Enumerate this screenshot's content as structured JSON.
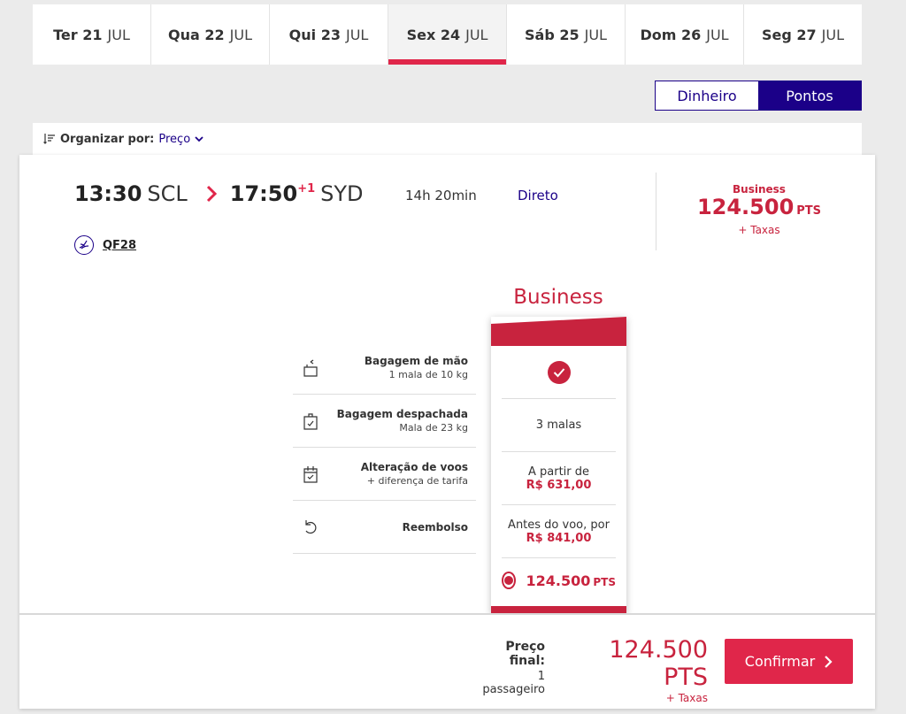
{
  "date_tabs": [
    {
      "day": "Ter 21",
      "month": "JUL"
    },
    {
      "day": "Qua 22",
      "month": "JUL"
    },
    {
      "day": "Qui 23",
      "month": "JUL"
    },
    {
      "day": "Sex 24",
      "month": "JUL",
      "active": true
    },
    {
      "day": "Sáb 25",
      "month": "JUL"
    },
    {
      "day": "Dom 26",
      "month": "JUL"
    },
    {
      "day": "Seg 27",
      "month": "JUL"
    }
  ],
  "currency_toggle": {
    "money": "Dinheiro",
    "points": "Pontos",
    "selected": "Pontos"
  },
  "sort": {
    "label": "Organizar por:",
    "value": "Preço"
  },
  "flight": {
    "depart_time": "13:30",
    "depart_airport": "SCL",
    "arrive_time": "17:50",
    "day_offset": "+1",
    "arrive_airport": "SYD",
    "duration": "14h 20min",
    "stops": "Direto",
    "flight_number": "QF28",
    "summary_cabin": "Business",
    "summary_amount": "124.500",
    "summary_unit": "PTS",
    "summary_tax": "+ Taxas"
  },
  "fare": {
    "title": "Business",
    "features": [
      {
        "icon": "carry-on-bag-icon",
        "title": "Bagagem de mão",
        "sub": "1 mala de 10 kg",
        "value_type": "check"
      },
      {
        "icon": "checked-bag-icon",
        "title": "Bagagem despachada",
        "sub": "Mala de 23 kg",
        "value": "3 malas"
      },
      {
        "icon": "calendar-change-icon",
        "title": "Alteração de voos",
        "sub": "+ diferença de tarifa",
        "value_line1": "A partir de",
        "value_line2": "R$ 631,00"
      },
      {
        "icon": "refund-icon",
        "title": "Reembolso",
        "sub": "",
        "value_line1": "Antes do voo, por",
        "value_line2": "R$ 841,00"
      }
    ],
    "select_amount": "124.500",
    "select_unit": "PTS"
  },
  "footer": {
    "label": "Preço final:",
    "passengers": "1 passageiro",
    "amount": "124.500 PTS",
    "tax": "+ Taxas",
    "confirm": "Confirmar"
  },
  "colors": {
    "brand_red": "#c8233e",
    "accent_red": "#e0264a",
    "brand_blue": "#1b0088"
  }
}
